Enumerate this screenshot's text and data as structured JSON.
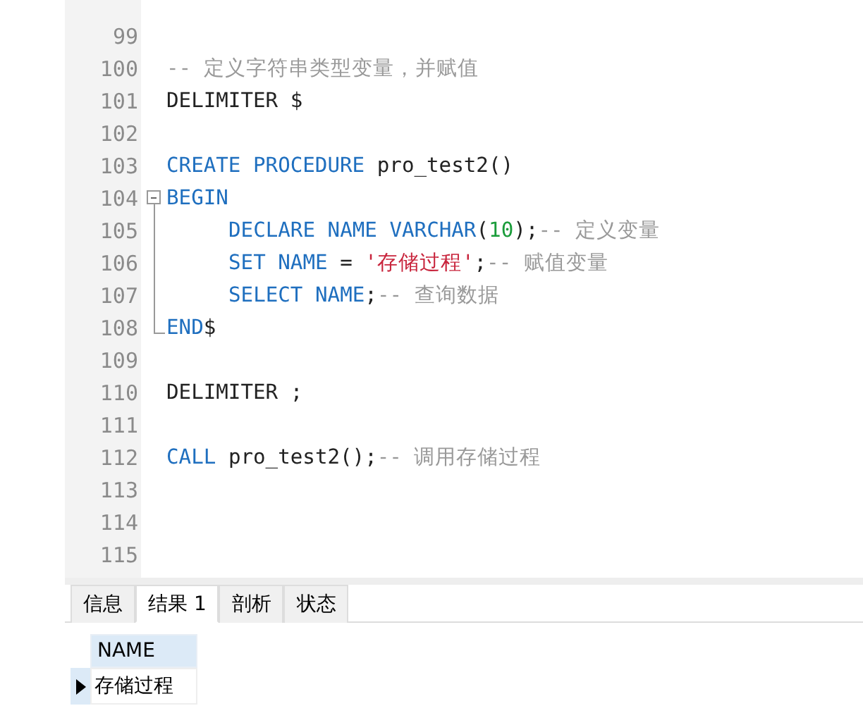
{
  "editor": {
    "lines": [
      {
        "number": "99",
        "kind": "code"
      },
      {
        "number": "100",
        "kind": "code",
        "tokens": [
          {
            "kind": "comment",
            "text": "-- 定义字符串类型变量，并赋值"
          }
        ]
      },
      {
        "number": "101",
        "kind": "code",
        "tokens": [
          {
            "kind": "plain",
            "text": "DELIMITER $"
          }
        ]
      },
      {
        "number": "102",
        "kind": "code"
      },
      {
        "number": "103",
        "kind": "code",
        "tokens": [
          {
            "kind": "keyword",
            "text": "CREATE PROCEDURE"
          },
          {
            "kind": "plain",
            "text": " pro_test2()"
          }
        ]
      },
      {
        "number": "104",
        "kind": "fold_start",
        "tokens": [
          {
            "kind": "keyword",
            "text": "BEGIN"
          }
        ]
      },
      {
        "number": "105",
        "kind": "fold_body",
        "indented": true,
        "tokens": [
          {
            "kind": "keyword",
            "text": "DECLARE NAME VARCHAR"
          },
          {
            "kind": "plain",
            "text": "("
          },
          {
            "kind": "number",
            "text": "10"
          },
          {
            "kind": "plain",
            "text": ");"
          },
          {
            "kind": "comment",
            "text": "-- 定义变量"
          }
        ]
      },
      {
        "number": "106",
        "kind": "fold_body",
        "indented": true,
        "tokens": [
          {
            "kind": "keyword",
            "text": "SET NAME"
          },
          {
            "kind": "plain",
            "text": " = "
          },
          {
            "kind": "string",
            "text": "'存储过程'"
          },
          {
            "kind": "plain",
            "text": ";"
          },
          {
            "kind": "comment",
            "text": "-- 赋值变量"
          }
        ]
      },
      {
        "number": "107",
        "kind": "fold_body",
        "indented": true,
        "tokens": [
          {
            "kind": "keyword",
            "text": "SELECT NAME"
          },
          {
            "kind": "plain",
            "text": ";"
          },
          {
            "kind": "comment",
            "text": "-- 查询数据"
          }
        ]
      },
      {
        "number": "108",
        "kind": "fold_end",
        "tokens": [
          {
            "kind": "keyword",
            "text": "END"
          },
          {
            "kind": "plain",
            "text": "$"
          }
        ]
      },
      {
        "number": "109",
        "kind": "code"
      },
      {
        "number": "110",
        "kind": "code",
        "tokens": [
          {
            "kind": "plain",
            "text": "DELIMITER ;"
          }
        ]
      },
      {
        "number": "111",
        "kind": "code"
      },
      {
        "number": "112",
        "kind": "code",
        "tokens": [
          {
            "kind": "keyword",
            "text": "CALL"
          },
          {
            "kind": "plain",
            "text": " pro_test2();"
          },
          {
            "kind": "comment",
            "text": "-- 调用存储过程"
          }
        ]
      },
      {
        "number": "113",
        "kind": "code"
      },
      {
        "number": "114",
        "kind": "code"
      },
      {
        "number": "115",
        "kind": "code"
      }
    ]
  },
  "tabs": [
    {
      "label": "信息",
      "selected": false
    },
    {
      "label": "结果 1",
      "selected": true
    },
    {
      "label": "剖析",
      "selected": false
    },
    {
      "label": "状态",
      "selected": false
    }
  ],
  "result": {
    "columns": [
      "NAME"
    ],
    "rows": [
      {
        "current": true,
        "cells": [
          "存储过程"
        ]
      }
    ]
  }
}
